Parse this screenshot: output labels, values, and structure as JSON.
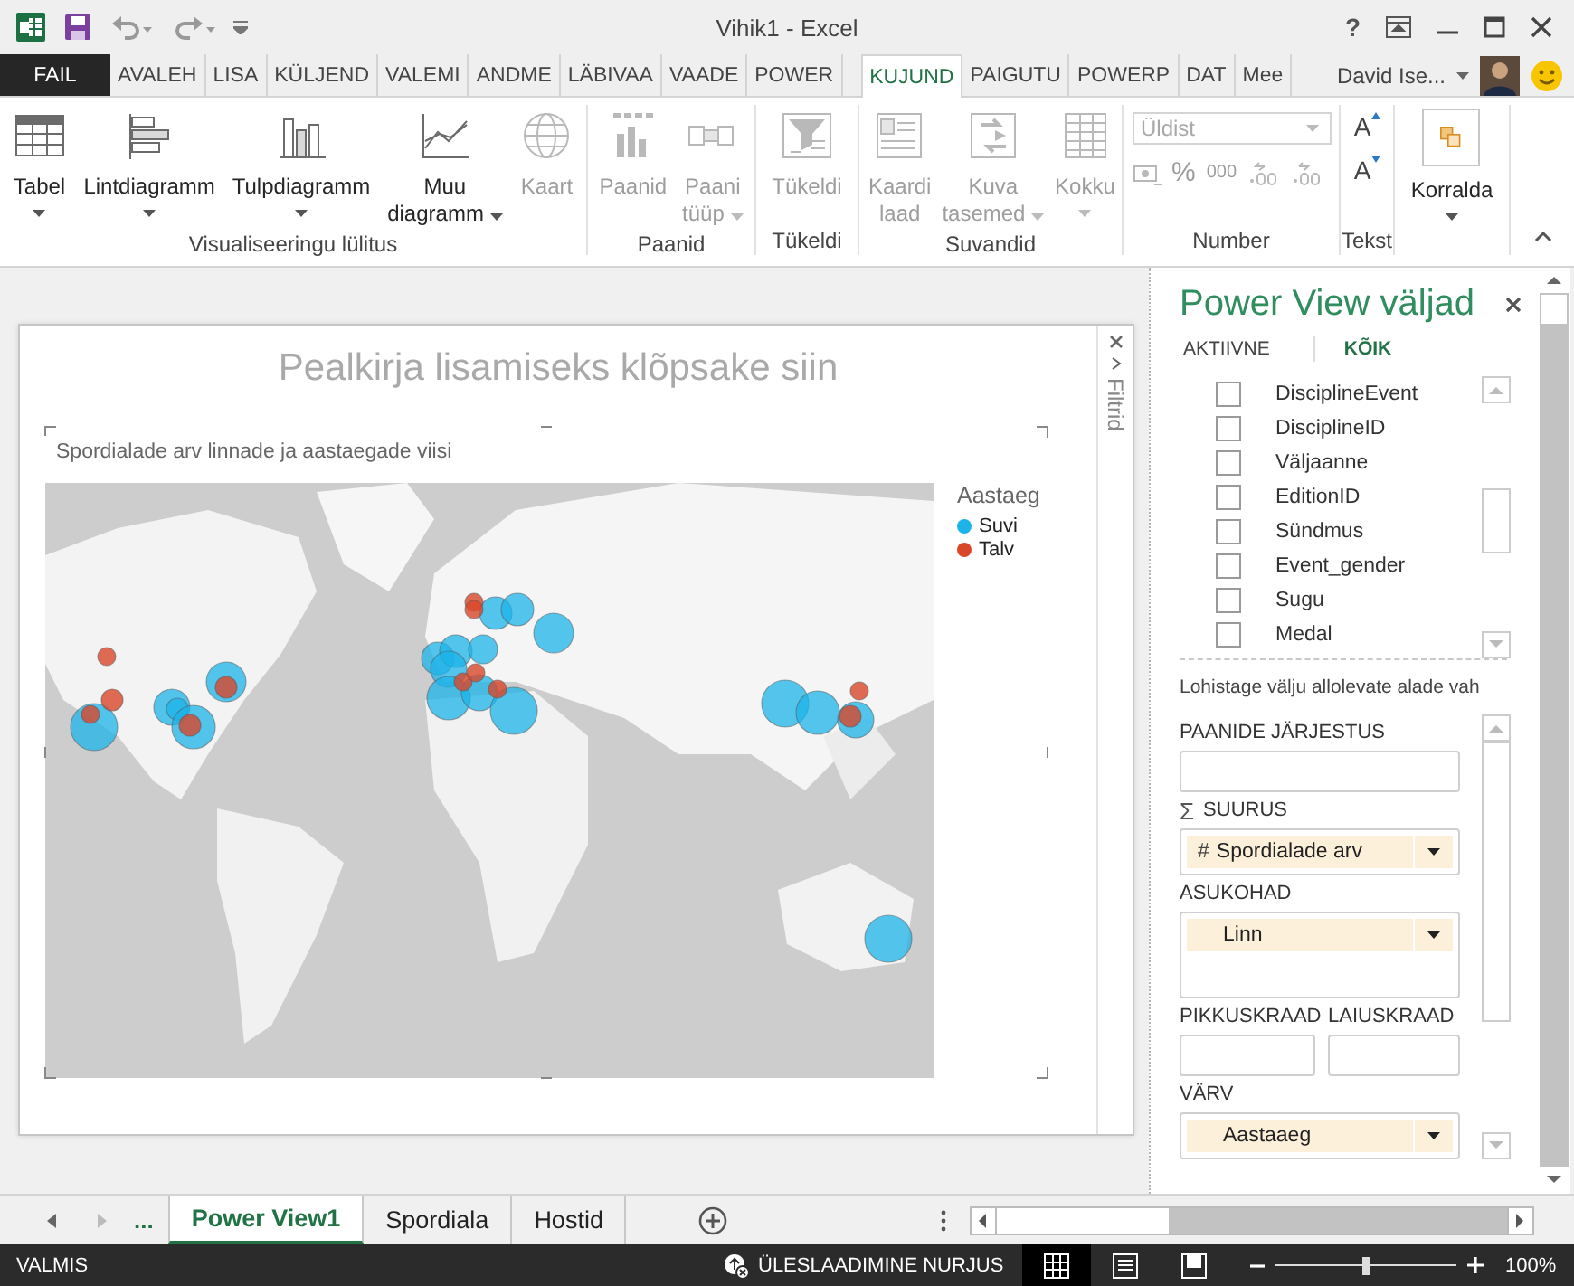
{
  "title_bar": {
    "title": "Vihik1 - Excel",
    "help": "?"
  },
  "ribbon_tabs": [
    {
      "label": "FAIL",
      "kind": "file",
      "selected": false
    },
    {
      "label": "AVALEH",
      "kind": "tab",
      "selected": false
    },
    {
      "label": "LISA",
      "kind": "tab",
      "selected": false
    },
    {
      "label": "KÜLJEND",
      "kind": "tab",
      "selected": false
    },
    {
      "label": "VALEMI",
      "kind": "tab",
      "selected": false
    },
    {
      "label": "ANDME",
      "kind": "tab",
      "selected": false
    },
    {
      "label": "LÄBIVAA",
      "kind": "tab",
      "selected": false
    },
    {
      "label": "VAADE",
      "kind": "tab",
      "selected": false
    },
    {
      "label": "POWER",
      "kind": "tab",
      "selected": false
    },
    {
      "label": "KUJUND",
      "kind": "tab",
      "selected": true
    },
    {
      "label": "PAIGUTU",
      "kind": "tab",
      "selected": false
    },
    {
      "label": "POWERP",
      "kind": "tab",
      "selected": false
    },
    {
      "label": "DAT",
      "kind": "tab",
      "selected": false
    },
    {
      "label": "Mee",
      "kind": "tab",
      "selected": false
    }
  ],
  "account": {
    "user": "David Ise..."
  },
  "ribbon": {
    "groups": [
      {
        "label": "Visualiseeringu lülitus",
        "kind": "buttons",
        "buttons": [
          {
            "label": "Tabel",
            "disabled": false,
            "dropdown": true
          },
          {
            "label": "Lintdiagramm",
            "disabled": false,
            "dropdown": true
          },
          {
            "label": "Tulpdiagramm",
            "disabled": false,
            "dropdown": true
          },
          {
            "label": "Muu\ndiagramm",
            "disabled": false,
            "dropdown": true
          },
          {
            "label": "Kaart",
            "disabled": true,
            "dropdown": false
          }
        ]
      },
      {
        "label": "Paanid",
        "kind": "buttons",
        "buttons": [
          {
            "label": "Paanid",
            "disabled": true,
            "dropdown": false
          },
          {
            "label": "Paani\ntüüp",
            "disabled": true,
            "dropdown": true
          }
        ]
      },
      {
        "label": "Tükeldi",
        "kind": "buttons",
        "buttons": [
          {
            "label": "Tükeldi",
            "disabled": true,
            "dropdown": false
          }
        ]
      },
      {
        "label": "Suvandid",
        "kind": "buttons",
        "buttons": [
          {
            "label": "Kaardi\nlaad",
            "disabled": true,
            "dropdown": false
          },
          {
            "label": "Kuva\ntasemed",
            "disabled": true,
            "dropdown": true
          },
          {
            "label": "Kokku",
            "disabled": true,
            "dropdown": true
          }
        ]
      },
      {
        "label": "Number",
        "kind": "number",
        "format": {
          "value": "Üldist",
          "disabled": true
        },
        "symbols": [
          "%",
          "000"
        ]
      },
      {
        "label": "Tekst",
        "kind": "text-size",
        "buttons": [
          {
            "label": "A",
            "kind": "grow"
          },
          {
            "label": "A",
            "kind": "shrink"
          }
        ]
      },
      {
        "kind": "buttons",
        "buttons": [
          {
            "label": "Korralda",
            "disabled": false,
            "dropdown": true
          }
        ]
      }
    ]
  },
  "canvas": {
    "title_placeholder": "Pealkirja lisamiseks klõpsake siin",
    "filters_label": "Filtrid",
    "chart": {
      "subtitle": "Spordialade arv linnade ja aastaegade viisi",
      "legend": {
        "title": "Aastaeg",
        "items": [
          {
            "label": "Suvi",
            "color": "#1cb3e8"
          },
          {
            "label": "Talv",
            "color": "#d9472b"
          }
        ]
      }
    }
  },
  "field_list": {
    "title": "Power View väljad",
    "tabs": [
      {
        "label": "AKTIIVNE",
        "selected": false
      },
      {
        "label": "KÕIK",
        "selected": true
      }
    ],
    "fields": [
      {
        "label": "DisciplineEvent",
        "checked": false
      },
      {
        "label": "DisciplineID",
        "checked": false
      },
      {
        "label": "Väljaanne",
        "checked": false
      },
      {
        "label": "EditionID",
        "checked": false
      },
      {
        "label": "Sündmus",
        "checked": false
      },
      {
        "label": "Event_gender",
        "checked": false
      },
      {
        "label": "Sugu",
        "checked": false
      },
      {
        "label": "Medal",
        "checked": false
      }
    ],
    "hint": "Lohistage välju allolevate alade vah",
    "areas": [
      {
        "label": "PAANIDE JÄRJESTUS",
        "kind": "single"
      },
      {
        "label": "SUURUS",
        "symbol": "Σ",
        "kind": "single",
        "items": [
          {
            "prefix": "#",
            "label": "Spordialade arv"
          }
        ]
      },
      {
        "label": "ASUKOHAD",
        "kind": "list",
        "items": [
          {
            "label": "Linn"
          }
        ]
      },
      {
        "label": "PIKKUSKRAAD",
        "kind": "half"
      },
      {
        "label": "LAIUSKRAAD",
        "kind": "half"
      },
      {
        "label": "VÄRV",
        "kind": "single",
        "items": [
          {
            "label": "Aastaaeg"
          }
        ]
      }
    ]
  },
  "sheet_tabs": {
    "more": "...",
    "tabs": [
      {
        "label": "Power View1",
        "selected": true
      },
      {
        "label": "Spordiala",
        "selected": false
      },
      {
        "label": "Hostid",
        "selected": false
      }
    ]
  },
  "status_bar": {
    "ready": "VALMIS",
    "upload": "ÜLESLAADIMINE NURJUS",
    "views": [
      {
        "kind": "normal",
        "selected": true
      },
      {
        "kind": "layout",
        "selected": false
      },
      {
        "kind": "break",
        "selected": false
      }
    ],
    "zoom": {
      "level": 0.5,
      "reading": "100%"
    }
  }
}
